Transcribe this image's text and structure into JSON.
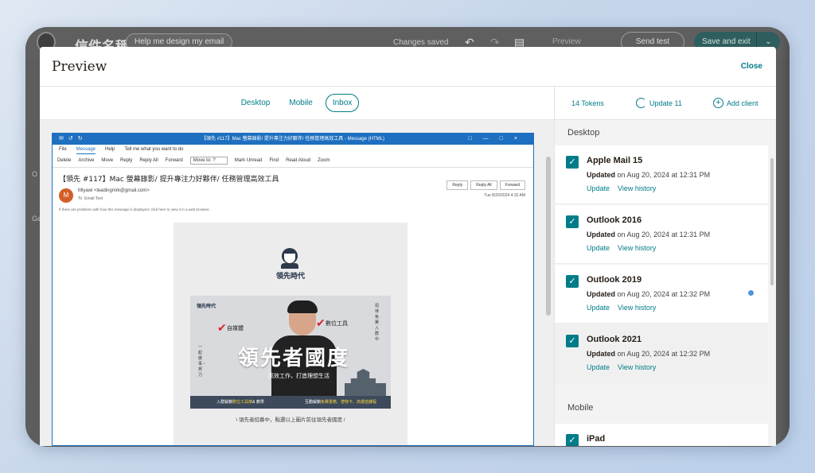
{
  "app": {
    "title": "信件名稱",
    "help_button": "Help me design my email",
    "status": "Changes saved",
    "preview_label": "Preview",
    "send_test": "Send test",
    "save_exit": "Save and exit",
    "side_letters": [
      "O",
      "Ge"
    ]
  },
  "modal": {
    "title": "Preview",
    "close": "Close",
    "tabs": [
      {
        "label": "Desktop",
        "active": false
      },
      {
        "label": "Mobile",
        "active": false
      },
      {
        "label": "Inbox",
        "active": true
      }
    ]
  },
  "right_panel": {
    "tokens": "14 Tokens",
    "update": "Update 11",
    "add_client": "Add client",
    "desktop_label": "Desktop",
    "mobile_label": "Mobile",
    "clients": [
      {
        "name": "Apple Mail 15",
        "updated_prefix": "Updated",
        "updated_rest": "on Aug 20, 2024 at 12:31 PM",
        "update_link": "Update",
        "history_link": "View history"
      },
      {
        "name": "Outlook 2016",
        "updated_prefix": "Updated",
        "updated_rest": "on Aug 20, 2024 at 12:31 PM",
        "update_link": "Update",
        "history_link": "View history"
      },
      {
        "name": "Outlook 2019",
        "updated_prefix": "Updated",
        "updated_rest": "on Aug 20, 2024 at 12:32 PM",
        "update_link": "Update",
        "history_link": "View history"
      },
      {
        "name": "Outlook 2021",
        "updated_prefix": "Updated",
        "updated_rest": "on Aug 20, 2024 at 12:32 PM",
        "update_link": "Update",
        "history_link": "View history"
      }
    ],
    "mobile_first": "iPad",
    "accent": "#007c89"
  },
  "outlook": {
    "window_title": "【領先 #117】Mac 螢幕錄影/ 提升專注力好夥伴/ 任務管理高效工具 - Message (HTML)",
    "menu": [
      "File",
      "Message",
      "Help",
      "Tell me what you want to do"
    ],
    "ribbon": [
      "Delete",
      "Archive",
      "Move",
      "Reply",
      "Reply All",
      "Forward",
      "Move to: ?",
      "Mark Unread",
      "Find",
      "Read Aloud",
      "Zoom"
    ],
    "subject": "【領先 #117】Mac 螢幕錄影/ 提升專注力好夥伴/ 任務管理高效工具",
    "avatar_letter": "M",
    "from": "Miyawi <leadingmrk@gmail.com>",
    "to_label": "To",
    "to": "Email Test",
    "actions": [
      "Reply",
      "Reply All",
      "Forward"
    ],
    "date": "Tue 8/20/2024 4:32 AM",
    "info": "If there are problems with how this message is displayed, click here to view it in a web browser."
  },
  "newsletter": {
    "logo_text": "領先時代",
    "brand_small": "領先時代",
    "tag_left": "自媒體",
    "tag_right": "數位工具",
    "headline": "領先者國度",
    "subline": "高效工作，打造理想生活",
    "left_vertical": "一起做事・努力",
    "right_vertical": "招待免費入群中",
    "strip_left_a": "入群解鎖",
    "strip_left_b": "數位工具庫",
    "strip_left_c": "& 教學",
    "strip_right_a": "互動解鎖",
    "strip_right_b": "免費書籍、禮物卡、高價值課程",
    "caption": "\\ 領先者招募中，點選以上圖片前往領先者國度 /"
  }
}
